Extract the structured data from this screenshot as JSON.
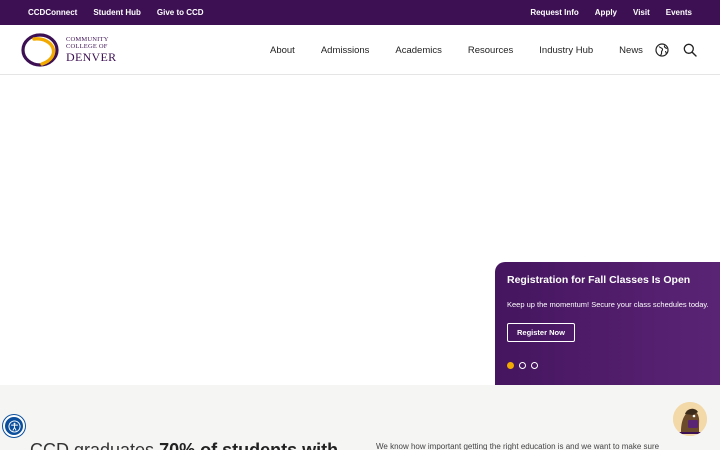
{
  "utility_nav": {
    "left": [
      "CCDConnect",
      "Student Hub",
      "Give to CCD"
    ],
    "right": [
      "Request Info",
      "Apply",
      "Visit",
      "Events"
    ]
  },
  "logo": {
    "line1": "COMMUNITY",
    "line2": "COLLEGE OF",
    "line3": "DENVER",
    "colors": {
      "purple": "#3c1053",
      "gold": "#f2a900"
    }
  },
  "main_nav": [
    "About",
    "Admissions",
    "Academics",
    "Resources",
    "Industry Hub",
    "News"
  ],
  "icons": {
    "globe": "globe-icon",
    "search": "search-icon",
    "accessibility": "accessibility-icon"
  },
  "slide": {
    "title": "Registration for Fall Classes Is Open",
    "body": "Keep up the momentum! Secure your class schedules today.",
    "button": "Register Now",
    "dot_count": 3,
    "active_dot": 1
  },
  "stats": {
    "headline_start": "CCD graduates ",
    "headline_bold": "70% of students with",
    "copy": "We know how important getting the right education is and we want to make sure"
  },
  "colors": {
    "brand_purple": "#3c1053",
    "accent_gold": "#f2a900",
    "a11y_blue": "#0b4f9c"
  }
}
